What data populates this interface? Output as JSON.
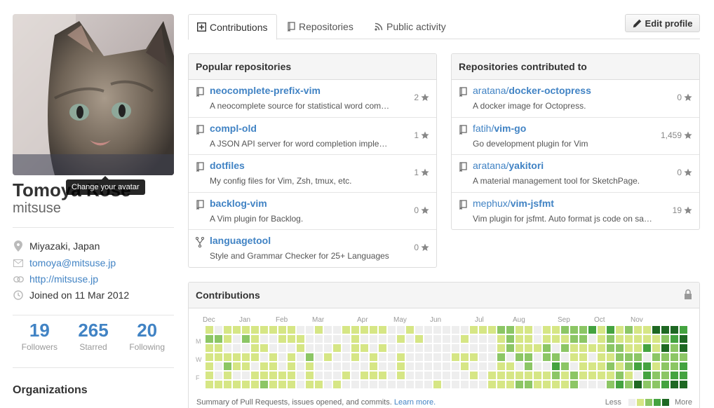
{
  "profile": {
    "fullname": "Tomoya Kose",
    "username": "mitsuse",
    "avatar_tooltip": "Change your avatar",
    "location": "Miyazaki, Japan",
    "email": "tomoya@mitsuse.jp",
    "website": "http://mitsuse.jp",
    "joined": "Joined on 11 Mar 2012",
    "icons": [
      "location-pin-icon",
      "mail-icon",
      "link-icon",
      "clock-icon"
    ]
  },
  "stats": [
    {
      "num": "19",
      "label": "Followers"
    },
    {
      "num": "265",
      "label": "Starred"
    },
    {
      "num": "20",
      "label": "Following"
    }
  ],
  "organizations_title": "Organizations",
  "tabs": [
    {
      "label": "Contributions",
      "icon": "plus-square-icon"
    },
    {
      "label": "Repositories",
      "icon": "repo-book-icon"
    },
    {
      "label": "Public activity",
      "icon": "rss-icon"
    }
  ],
  "edit_profile": "Edit profile",
  "popular": {
    "title": "Popular repositories",
    "repos": [
      {
        "name": "neocomplete-prefix-vim",
        "desc": "A neocomplete source for statistical word com…",
        "stars": "2",
        "icon": "repo-book-icon"
      },
      {
        "name": "compl-old",
        "desc": "A JSON API server for word completion imple…",
        "stars": "1",
        "icon": "repo-book-icon"
      },
      {
        "name": "dotfiles",
        "desc": "My config files for Vim, Zsh, tmux, etc.",
        "stars": "1",
        "icon": "repo-book-icon"
      },
      {
        "name": "backlog-vim",
        "desc": "A Vim plugin for Backlog.",
        "stars": "0",
        "icon": "repo-book-icon"
      },
      {
        "name": "languagetool",
        "desc": "Style and Grammar Checker for 25+ Languages",
        "stars": "0",
        "icon": "fork-icon"
      }
    ]
  },
  "contributed": {
    "title": "Repositories contributed to",
    "repos": [
      {
        "owner": "aratana/",
        "name": "docker-octopress",
        "desc": "A docker image for Octopress.",
        "stars": "0"
      },
      {
        "owner": "fatih/",
        "name": "vim-go",
        "desc": "Go development plugin for Vim",
        "stars": "1,459"
      },
      {
        "owner": "aratana/",
        "name": "yakitori",
        "desc": "A material management tool for SketchPage.",
        "stars": "0"
      },
      {
        "owner": "mephux/",
        "name": "vim-jsfmt",
        "desc": "Vim plugin for jsfmt. Auto format js code on sa…",
        "stars": "19"
      }
    ]
  },
  "contributions": {
    "title": "Contributions",
    "months": [
      "Dec",
      "Jan",
      "Feb",
      "Mar",
      "Apr",
      "May",
      "Jun",
      "Jul",
      "Aug",
      "Sep",
      "Oct",
      "Nov"
    ],
    "days": [
      "M",
      "W",
      "F"
    ],
    "summary": "Summary of Pull Requests, issues opened, and commits.",
    "learn_more": "Learn more.",
    "legend_less": "Less",
    "legend_more": "More",
    "colors": [
      "#eeeeee",
      "#d6e685",
      "#8cc665",
      "#44a340",
      "#1e6823"
    ]
  }
}
